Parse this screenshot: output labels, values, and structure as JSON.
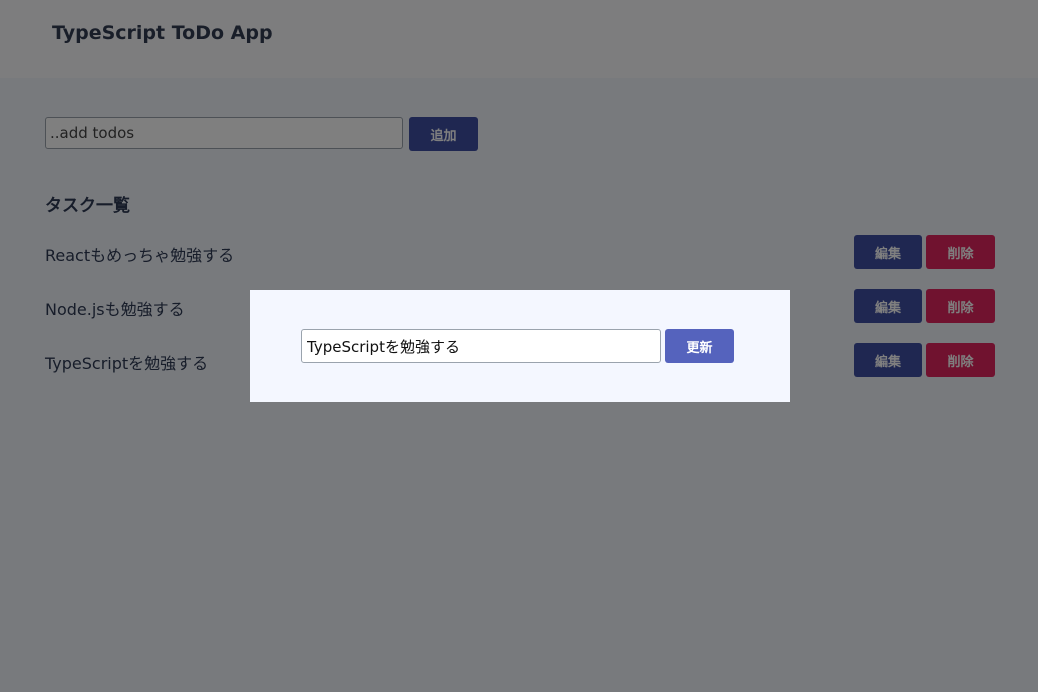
{
  "header": {
    "title": "TypeScript ToDo App"
  },
  "add_form": {
    "placeholder": "..add todos",
    "value": "",
    "button_label": "追加"
  },
  "list": {
    "title": "タスク一覧",
    "items": [
      {
        "text": "Reactもめっちゃ勉強する",
        "edit_label": "編集",
        "delete_label": "削除"
      },
      {
        "text": "Node.jsも勉強する",
        "edit_label": "編集",
        "delete_label": "削除"
      },
      {
        "text": "TypeScriptを勉強する",
        "edit_label": "編集",
        "delete_label": "削除"
      }
    ]
  },
  "modal": {
    "input_value": "TypeScriptを勉強する",
    "update_label": "更新"
  },
  "colors": {
    "primary": "#3e4ea3",
    "danger": "#e0255f",
    "modal_button": "#5563bd",
    "background": "#f1f5fb"
  }
}
